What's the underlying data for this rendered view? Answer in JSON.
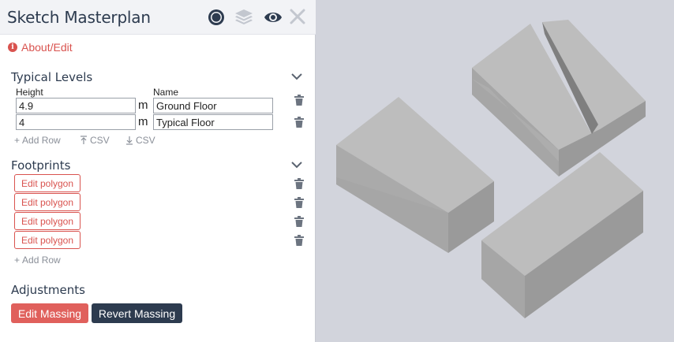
{
  "header": {
    "title": "Sketch Masterplan"
  },
  "about": {
    "label": "About/Edit",
    "info_glyph": "i"
  },
  "typical_levels": {
    "title": "Typical Levels",
    "height_label": "Height",
    "name_label": "Name",
    "unit": "m",
    "rows": [
      {
        "height": "4.9",
        "name": "Ground Floor"
      },
      {
        "height": "4",
        "name": "Typical Floor"
      }
    ],
    "add_row": "Add Row",
    "import_csv": "CSV",
    "export_csv": "CSV"
  },
  "footprints": {
    "title": "Footprints",
    "items": [
      "Edit polygon",
      "Edit polygon",
      "Edit polygon",
      "Edit polygon"
    ],
    "add_row": "Add Row"
  },
  "adjustments": {
    "title": "Adjustments",
    "edit_massing": "Edit Massing",
    "revert_massing": "Revert Massing"
  },
  "colors": {
    "header_text": "#2d3b4f",
    "accent_red": "#d9534f",
    "dark_button": "#2d3b4f",
    "viewport_bg": "#d2d4dc",
    "mass_top": "#bdbdbd",
    "mass_left": "#a4a4a4",
    "mass_right": "#999999"
  }
}
